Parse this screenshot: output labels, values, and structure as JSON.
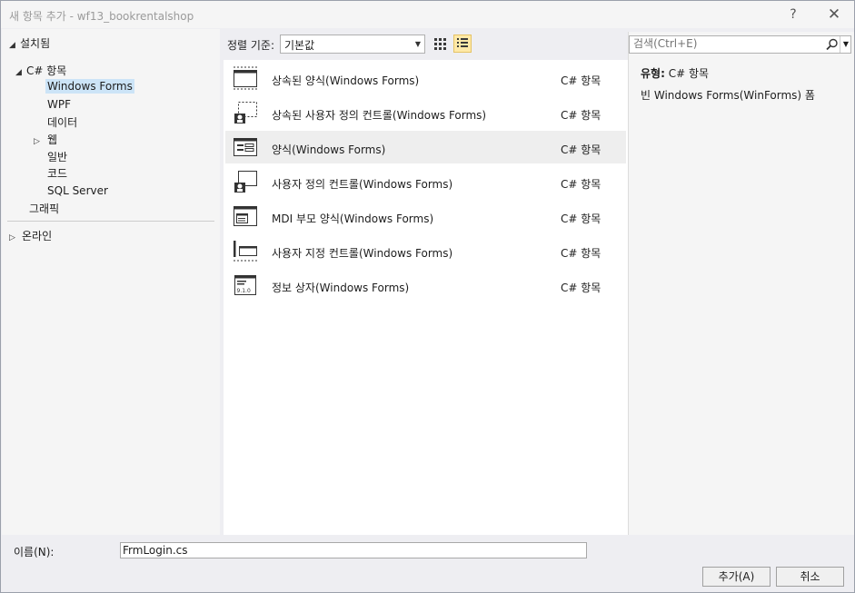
{
  "window": {
    "title": "새 항목 추가 - wf13_bookrentalshop",
    "help_label": "?",
    "close_label": "✕"
  },
  "left": {
    "installed_label": "설치됨",
    "tree": [
      {
        "label": "C# 항목"
      },
      {
        "label": "Windows Forms"
      },
      {
        "label": "WPF"
      },
      {
        "label": "데이터"
      },
      {
        "label": "웹"
      },
      {
        "label": "일반"
      },
      {
        "label": "코드"
      },
      {
        "label": "SQL Server"
      },
      {
        "label": "그래픽"
      }
    ],
    "online_label": "온라인"
  },
  "toolbar": {
    "sort_label": "정렬 기준:",
    "sort_value": "기본값"
  },
  "items": [
    {
      "name": "상속된 양식(Windows Forms)",
      "category": "C# 항목",
      "icon": "inherited-form-icon"
    },
    {
      "name": "상속된 사용자 정의 컨트롤(Windows Forms)",
      "category": "C# 항목",
      "icon": "inherited-user-control-icon"
    },
    {
      "name": "양식(Windows Forms)",
      "category": "C# 항목",
      "icon": "form-icon"
    },
    {
      "name": "사용자 정의 컨트롤(Windows Forms)",
      "category": "C# 항목",
      "icon": "user-control-icon"
    },
    {
      "name": "MDI 부모 양식(Windows Forms)",
      "category": "C# 항목",
      "icon": "mdi-parent-form-icon"
    },
    {
      "name": "사용자 지정 컨트롤(Windows Forms)",
      "category": "C# 항목",
      "icon": "custom-control-icon"
    },
    {
      "name": "정보 상자(Windows Forms)",
      "category": "C# 항목",
      "icon": "about-box-icon"
    }
  ],
  "right": {
    "search_placeholder": "검색(Ctrl+E)",
    "type_label": "유형:",
    "type_value": "C# 항목",
    "description": "빈 Windows Forms(WinForms) 폼"
  },
  "bottom": {
    "name_label": "이름(N):",
    "name_value": "FrmLogin.cs",
    "add_label": "추가(A)",
    "cancel_label": "취소"
  },
  "colors": {
    "selection": "#cce4f7",
    "active_view": "#ffe9a8"
  }
}
